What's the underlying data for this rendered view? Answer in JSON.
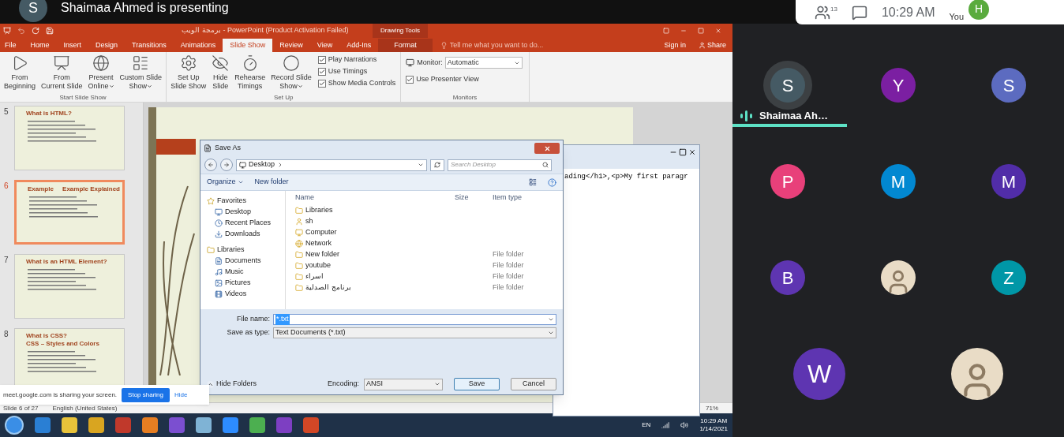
{
  "meet_header": {
    "presenter_initial": "S",
    "presenting_text": "Shaimaa Ahmed is presenting"
  },
  "meet_panel": {
    "participant_count": "13",
    "time": "10:29 AM",
    "you_label": "You",
    "you_initial": "H"
  },
  "powerpoint": {
    "title": "برمجة الويب - PowerPoint (Product Activation Failed)",
    "contextual_label": "Drawing Tools",
    "tabs": [
      {
        "label": "File",
        "kind": "file",
        "selected": false
      },
      {
        "label": "Home",
        "kind": "normal",
        "selected": false
      },
      {
        "label": "Insert",
        "kind": "normal",
        "selected": false
      },
      {
        "label": "Design",
        "kind": "normal",
        "selected": false
      },
      {
        "label": "Transitions",
        "kind": "normal",
        "selected": false
      },
      {
        "label": "Animations",
        "kind": "normal",
        "selected": false
      },
      {
        "label": "Slide Show",
        "kind": "normal",
        "selected": true
      },
      {
        "label": "Review",
        "kind": "normal",
        "selected": false
      },
      {
        "label": "View",
        "kind": "normal",
        "selected": false
      },
      {
        "label": "Add-Ins",
        "kind": "normal",
        "selected": false
      },
      {
        "label": "Format",
        "kind": "contextual",
        "selected": false
      }
    ],
    "tell_me": "Tell me what you want to do...",
    "sign_in": "Sign in",
    "share": "Share",
    "ribbon_groups": [
      {
        "name": "Start Slide Show",
        "buttons": [
          {
            "lines": [
              "From",
              "Beginning"
            ],
            "dropdown": false
          },
          {
            "lines": [
              "From",
              "Current Slide"
            ],
            "dropdown": false
          },
          {
            "lines": [
              "Present",
              "Online"
            ],
            "dropdown": true
          },
          {
            "lines": [
              "Custom Slide",
              "Show"
            ],
            "dropdown": true
          }
        ]
      },
      {
        "name": "Set Up",
        "buttons": [
          {
            "lines": [
              "Set Up",
              "Slide Show"
            ],
            "dropdown": false
          },
          {
            "lines": [
              "Hide",
              "Slide"
            ],
            "dropdown": false
          },
          {
            "lines": [
              "Rehearse",
              "Timings"
            ],
            "dropdown": false
          },
          {
            "lines": [
              "Record Slide",
              "Show"
            ],
            "dropdown": true
          }
        ],
        "checkboxes": [
          {
            "label": "Play Narrations",
            "checked": true
          },
          {
            "label": "Use Timings",
            "checked": true
          },
          {
            "label": "Show Media Controls",
            "checked": true
          }
        ]
      },
      {
        "name": "Monitors",
        "monitor_label": "Monitor:",
        "monitor_value": "Automatic",
        "checkboxes": [
          {
            "label": "Use Presenter View",
            "checked": true
          }
        ]
      }
    ],
    "slides": [
      {
        "number": "5",
        "selected": false,
        "titles": [
          "What is HTML?"
        ]
      },
      {
        "number": "6",
        "selected": true,
        "titles": [
          "Example",
          "Example Explained"
        ]
      },
      {
        "number": "7",
        "selected": false,
        "titles": [
          "What is an HTML Element?"
        ]
      },
      {
        "number": "8",
        "selected": false,
        "titles": [
          "What is CSS?",
          "CSS – Styles and Colors"
        ]
      }
    ],
    "status_bar": {
      "slide_info": "Slide 6 of 27",
      "language": "English (United States)",
      "zoom": "71%"
    }
  },
  "notepad": {
    "text": "ading</h1>,<p>My first paragr"
  },
  "save_dialog": {
    "title": "Save As",
    "location": "Desktop",
    "search_placeholder": "Search Desktop",
    "organize": "Organize",
    "new_folder": "New folder",
    "nav": [
      {
        "label": "Favorites",
        "kind": "favorites",
        "children": [
          {
            "label": "Desktop",
            "kind": "desktop"
          },
          {
            "label": "Recent Places",
            "kind": "recent"
          },
          {
            "label": "Downloads",
            "kind": "downloads"
          }
        ]
      },
      {
        "label": "Libraries",
        "kind": "libraries",
        "children": [
          {
            "label": "Documents",
            "kind": "documents"
          },
          {
            "label": "Music",
            "kind": "music"
          },
          {
            "label": "Pictures",
            "kind": "pictures"
          },
          {
            "label": "Videos",
            "kind": "videos"
          }
        ]
      }
    ],
    "columns": [
      "Name",
      "Size",
      "Item type"
    ],
    "files": [
      {
        "name": "Libraries",
        "kind": "libraries"
      },
      {
        "name": "sh",
        "kind": "user"
      },
      {
        "name": "Computer",
        "kind": "computer"
      },
      {
        "name": "Network",
        "kind": "network"
      },
      {
        "name": "New folder",
        "kind": "folder",
        "type": "File folder"
      },
      {
        "name": "youtube",
        "kind": "folder",
        "type": "File folder"
      },
      {
        "name": "اسراء",
        "kind": "folder",
        "type": "File folder"
      },
      {
        "name": "برنامج الصدلية",
        "kind": "folder",
        "type": "File folder"
      }
    ],
    "file_name_label": "File name:",
    "file_name": "*.txt",
    "save_type_label": "Save as type:",
    "save_type": "Text Documents (*.txt)",
    "hide_folders": "Hide Folders",
    "encoding_label": "Encoding:",
    "encoding": "ANSI",
    "save": "Save",
    "cancel": "Cancel"
  },
  "share_bar": {
    "message": "meet.google.com is sharing your screen.",
    "stop": "Stop sharing",
    "hide": "Hide"
  },
  "taskbar": {
    "language": "EN",
    "time": "10:29 AM",
    "date": "1/14/2021"
  },
  "participants": [
    [
      {
        "kind": "letter",
        "initial": "S",
        "color": "#455a64",
        "name": "Shaimaa Ah…",
        "speaking": true
      },
      {
        "kind": "letter",
        "initial": "Y",
        "color": "#7b1fa2",
        "speaking": false
      },
      {
        "kind": "letter",
        "initial": "S",
        "color": "#5c6bc0",
        "speaking": false
      }
    ],
    [
      {
        "kind": "letter",
        "initial": "P",
        "color": "#e8407a",
        "speaking": false
      },
      {
        "kind": "letter",
        "initial": "M",
        "color": "#0288d1",
        "speaking": false
      },
      {
        "kind": "letter",
        "initial": "M",
        "color": "#512da8",
        "speaking": false
      }
    ],
    [
      {
        "kind": "letter",
        "initial": "B",
        "color": "#5e35b1",
        "speaking": false
      },
      {
        "kind": "photo",
        "speaking": false
      },
      {
        "kind": "letter",
        "initial": "Z",
        "color": "#0097a7",
        "speaking": false
      }
    ],
    [
      {
        "kind": "letter",
        "initial": "W",
        "color": "#5e35b1",
        "speaking": false,
        "large": true
      },
      {
        "kind": "photo",
        "speaking": false,
        "large": true
      }
    ]
  ]
}
